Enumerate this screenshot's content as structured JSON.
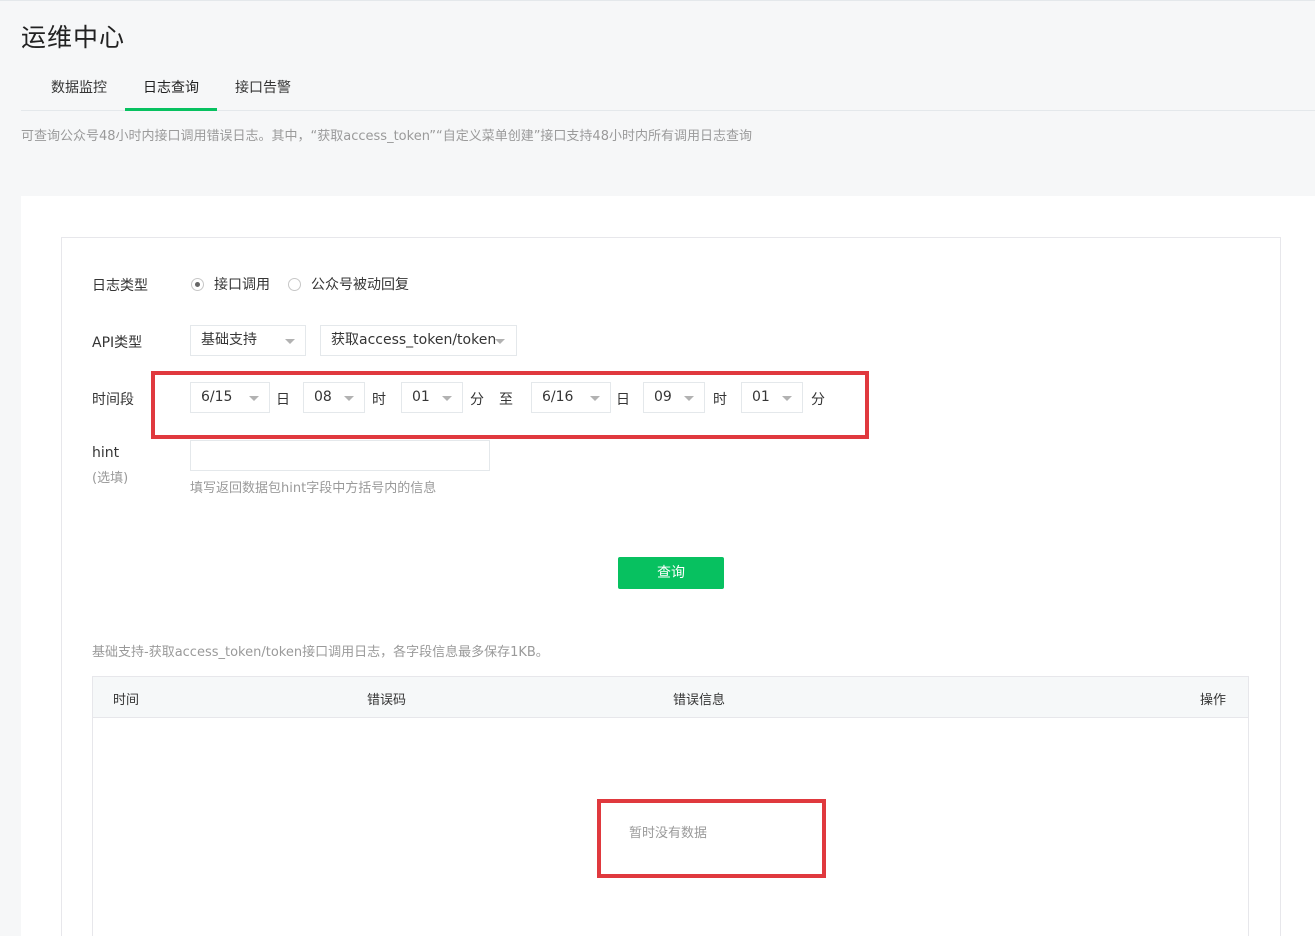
{
  "page_title": "运维中心",
  "tabs": [
    {
      "label": "数据监控",
      "active": false
    },
    {
      "label": "日志查询",
      "active": true
    },
    {
      "label": "接口告警",
      "active": false
    }
  ],
  "description": "可查询公众号48小时内接口调用错误日志。其中，“获取access_token”“自定义菜单创建”接口支持48小时内所有调用日志查询",
  "form": {
    "log_type": {
      "label": "日志类型",
      "options": [
        {
          "label": "接口调用",
          "checked": true
        },
        {
          "label": "公众号被动回复",
          "checked": false
        }
      ]
    },
    "api_type": {
      "label": "API类型",
      "category": "基础支持",
      "api": "获取access_token/token"
    },
    "time_range": {
      "label": "时间段",
      "start_date": "6/15",
      "day_unit": "日",
      "start_hour": "08",
      "hour_unit": "时",
      "start_minute": "01",
      "minute_unit": "分",
      "to": "至",
      "end_date": "6/16",
      "end_hour": "09",
      "end_minute": "01"
    },
    "hint": {
      "label": "hint",
      "optional": "(选填)",
      "value": "",
      "help": "填写返回数据包hint字段中方括号内的信息"
    },
    "query_button": "查询"
  },
  "results": {
    "note": "基础支持-获取access_token/token接口调用日志，各字段信息最多保存1KB。",
    "columns": [
      "时间",
      "错误码",
      "错误信息",
      "操作"
    ],
    "rows": [],
    "empty_text": "暂时没有数据"
  },
  "colors": {
    "accent": "#07c160",
    "highlight": "#e0393e",
    "muted_text": "#9a9a9a"
  }
}
